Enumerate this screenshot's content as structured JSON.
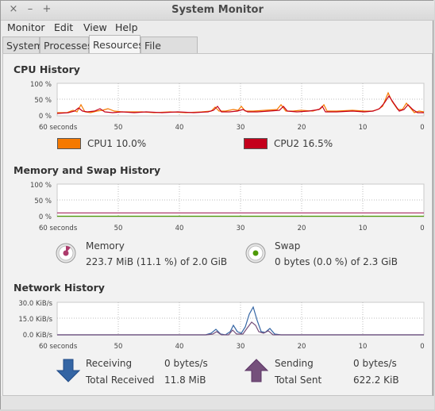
{
  "window": {
    "title": "System Monitor",
    "close_glyph": "×",
    "minimize_glyph": "–",
    "maximize_glyph": "+"
  },
  "menu": [
    {
      "label": "Monitor"
    },
    {
      "label": "Edit"
    },
    {
      "label": "View"
    },
    {
      "label": "Help"
    }
  ],
  "tabs": [
    {
      "label": "System",
      "active": false
    },
    {
      "label": "Processes",
      "active": false
    },
    {
      "label": "Resources",
      "active": true
    },
    {
      "label": "File Systems",
      "active": false
    }
  ],
  "cpu": {
    "title": "CPU History",
    "y_ticks": [
      "100 %",
      "50 %",
      "0 %"
    ],
    "x_ticks": [
      "60 seconds",
      "50",
      "40",
      "30",
      "20",
      "10",
      "0"
    ],
    "cpu1_label": "CPU1",
    "cpu1_value": "10.0%",
    "cpu1_color": "#f57900",
    "cpu2_label": "CPU2",
    "cpu2_value": "16.5%",
    "cpu2_color": "#c4001c"
  },
  "memory": {
    "title": "Memory and Swap History",
    "y_ticks": [
      "100 %",
      "50 %",
      "0 %"
    ],
    "x_ticks": [
      "60 seconds",
      "50",
      "40",
      "30",
      "20",
      "10",
      "0"
    ],
    "memory_label": "Memory",
    "memory_value": "223.7 MiB (11.1 %) of 2.0 GiB",
    "memory_fraction": 0.111,
    "memory_color": "#ad3b6c",
    "swap_label": "Swap",
    "swap_value": "0 bytes (0.0 %) of 2.3 GiB",
    "swap_fraction": 0.0,
    "swap_color": "#4e9a06"
  },
  "network": {
    "title": "Network History",
    "y_ticks": [
      "30.0 KiB/s",
      "15.0 KiB/s",
      "0.0 KiB/s"
    ],
    "x_ticks": [
      "60 seconds",
      "50",
      "40",
      "30",
      "20",
      "10",
      "0"
    ],
    "receiving_label": "Receiving",
    "receiving_value": "0 bytes/s",
    "total_received_label": "Total Received",
    "total_received_value": "11.8 MiB",
    "receiving_color": "#3465a4",
    "sending_label": "Sending",
    "sending_value": "0 bytes/s",
    "total_sent_label": "Total Sent",
    "total_sent_value": "622.2 KiB",
    "sending_color": "#75507b"
  }
}
